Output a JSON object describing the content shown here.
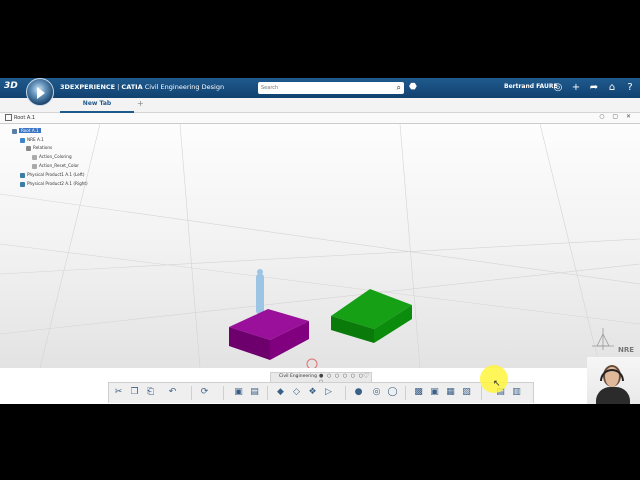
{
  "app": {
    "brand": "3D",
    "title_main": "3DEXPERIENCE",
    "title_sep": " | ",
    "title_product": "CATIA",
    "title_app": "Civil Engineering Design",
    "search_placeholder": "Search",
    "user_name": "Bertrand FAURE"
  },
  "tabs": {
    "active": "New Tab",
    "add": "+"
  },
  "breadcrumb": {
    "path": "Root A.1"
  },
  "tree": {
    "root": "Root A.1",
    "nodes": [
      {
        "label": "NRE A.1"
      },
      {
        "label": "Relations"
      },
      {
        "label": "Action_Coloring"
      },
      {
        "label": "Action_Reset_Color"
      },
      {
        "label": "Physical Product1 A.1 (Left)"
      },
      {
        "label": "Physical Product2 A.1 (Right)"
      }
    ]
  },
  "viewport": {
    "nre_label": "NRE",
    "objects": [
      {
        "name": "purple-box",
        "color": "#7a007a"
      },
      {
        "name": "green-box",
        "color": "#0a8a0a"
      }
    ]
  },
  "actionbar": {
    "section_label": "Civil Engineering",
    "dots": "● ○ ○ ○ ○ ○ ○",
    "heart": "♡"
  },
  "icons": [
    "search-icon",
    "tag-icon",
    "compass-icon",
    "add-icon",
    "share-icon",
    "home-icon",
    "help-icon",
    "cut-icon",
    "copy-icon",
    "paste-icon",
    "undo-icon",
    "update-icon"
  ]
}
